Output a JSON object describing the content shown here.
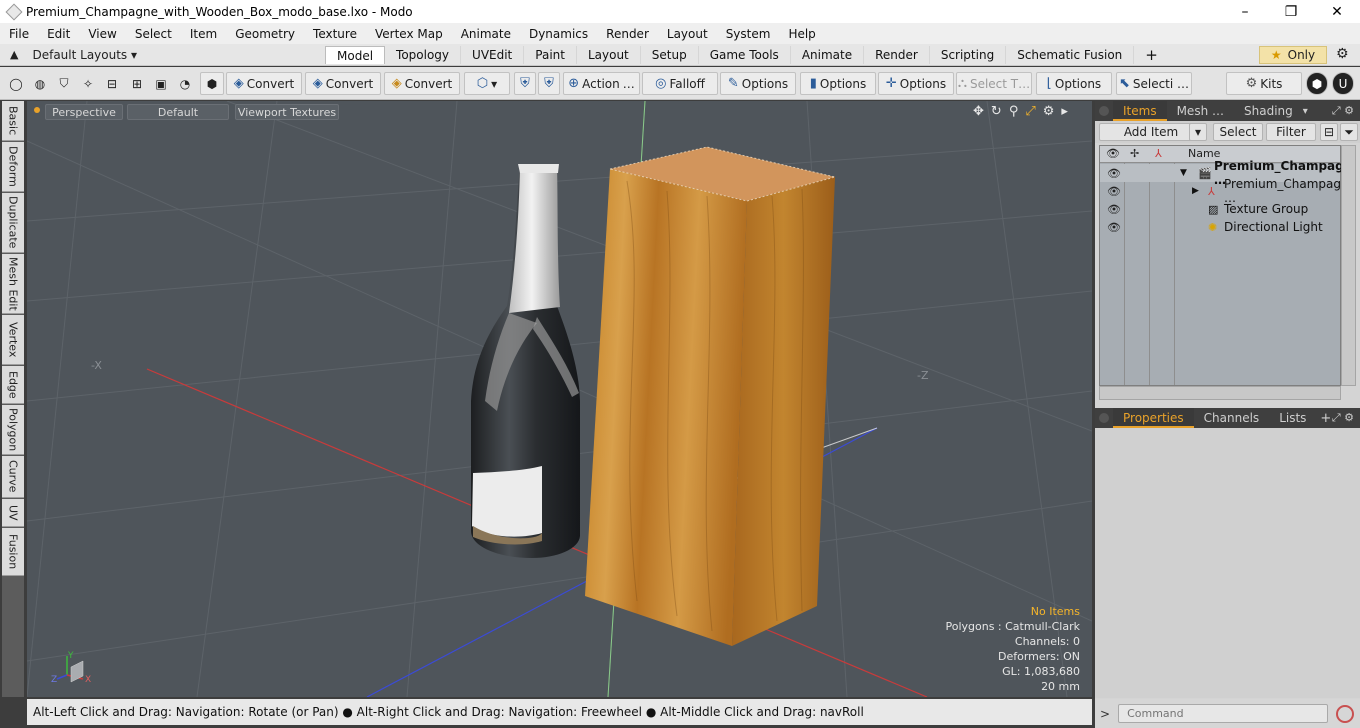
{
  "window": {
    "title": "Premium_Champagne_with_Wooden_Box_modo_base.lxo - Modo",
    "min_glyph": "–",
    "max_glyph": "❐",
    "close_glyph": "✕"
  },
  "menu": [
    "File",
    "Edit",
    "View",
    "Select",
    "Item",
    "Geometry",
    "Texture",
    "Vertex Map",
    "Animate",
    "Dynamics",
    "Render",
    "Layout",
    "System",
    "Help"
  ],
  "layout_bar": {
    "layouts_label": "Default Layouts ▾",
    "tabs": [
      "Model",
      "Topology",
      "UVEdit",
      "Paint",
      "Layout",
      "Setup",
      "Game Tools",
      "Animate",
      "Render",
      "Scripting",
      "Schematic Fusion"
    ],
    "active_tab": "Model",
    "add_tab": "+",
    "only_label": "Only",
    "only_star": "★"
  },
  "toolbar": {
    "convert1": "Convert",
    "convert2": "Convert",
    "convert3": "Convert",
    "action": "Action",
    "action_more": "…",
    "falloff": "Falloff",
    "options1": "Options",
    "options2": "Options",
    "options3": "Options",
    "select_t": "Select T…",
    "options4": "Options",
    "selecti": "Selecti …",
    "kits": "Kits"
  },
  "side_tabs": [
    "Basic",
    "Deform",
    "Duplicate",
    "Mesh Edit",
    "Vertex",
    "Edge",
    "Polygon",
    "Curve",
    "UV",
    "Fusion"
  ],
  "viewport": {
    "perspective": "Perspective",
    "default": "Default",
    "textures": "Viewport Textures",
    "axis_minus_x": "-X",
    "axis_minus_z": "-Z",
    "gizmo_y": "Y",
    "gizmo_z": "Z",
    "gizmo_x": "X",
    "stats": {
      "no_items": "No Items",
      "polygons": "Polygons : Catmull-Clark",
      "channels": "Channels: 0",
      "deformers": "Deformers: ON",
      "gl": "GL: 1,083,680",
      "size": "20 mm"
    },
    "colors": {
      "background": "#4f555b",
      "x_axis": "#c83b3b",
      "y_axis": "#3dbb3d",
      "z_axis": "#3b4bd6",
      "wood": "#c98a34"
    }
  },
  "status_bar": "Alt-Left Click and Drag: Navigation: Rotate (or Pan) ● Alt-Right Click and Drag: Navigation: Freewheel ● Alt-Middle Click and Drag: navRoll",
  "items_panel": {
    "tabs": [
      "Items",
      "Mesh …",
      "Shading"
    ],
    "active_tab": "Items",
    "add_item": "Add Item",
    "select": "Select",
    "filter": "Filter",
    "column_name": "Name",
    "rows": [
      {
        "label": "Premium_Champag …",
        "icon": "scene-icon",
        "bold": true,
        "expander": "▼"
      },
      {
        "label": "Premium_Champagn …",
        "icon": "mesh-icon",
        "bold": false,
        "expander": "▶"
      },
      {
        "label": "Texture Group",
        "icon": "texture-group-icon",
        "bold": false,
        "expander": ""
      },
      {
        "label": "Directional Light",
        "icon": "light-icon",
        "bold": false,
        "expander": ""
      }
    ]
  },
  "properties_panel": {
    "tabs": [
      "Properties",
      "Channels",
      "Lists"
    ],
    "active_tab": "Properties",
    "add": "+"
  },
  "command": {
    "placeholder": "Command",
    "prompt": ">"
  }
}
